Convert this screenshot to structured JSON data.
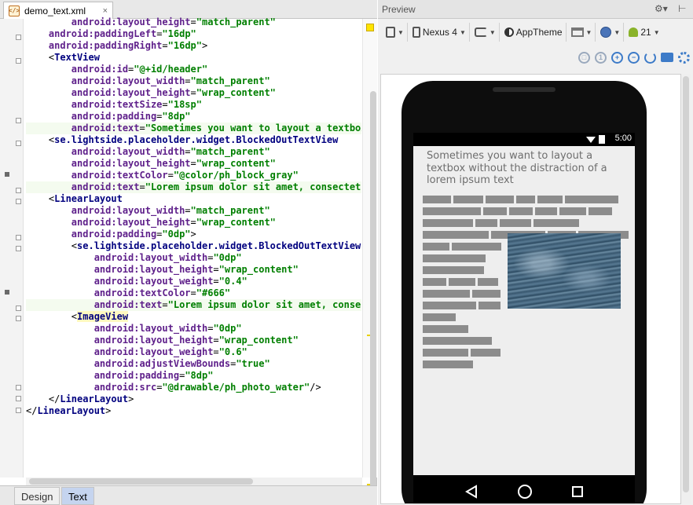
{
  "editor": {
    "file_tab": {
      "name": "demo_text.xml",
      "close": "×"
    },
    "lines": [
      "        android:layout_height=\"match_parent\"",
      "    android:paddingLeft=\"16dp\"",
      "    android:paddingRight=\"16dp\">",
      "    <TextView",
      "        android:id=\"@+id/header\"",
      "        android:layout_width=\"match_parent\"",
      "        android:layout_height=\"wrap_content\"",
      "        android:textSize=\"18sp\"",
      "        android:padding=\"8dp\"",
      "        android:text=\"Sometimes you want to layout a textbox",
      "    <se.lightside.placeholder.widget.BlockedOutTextView",
      "        android:layout_width=\"match_parent\"",
      "        android:layout_height=\"wrap_content\"",
      "        android:textColor=\"@color/ph_block_gray\"",
      "        android:text=\"Lorem ipsum dolor sit amet, consectetur",
      "    <LinearLayout",
      "        android:layout_width=\"match_parent\"",
      "        android:layout_height=\"wrap_content\"",
      "        android:padding=\"0dp\">",
      "        <se.lightside.placeholder.widget.BlockedOutTextView",
      "            android:layout_width=\"0dp\"",
      "            android:layout_height=\"wrap_content\"",
      "            android:layout_weight=\"0.4\"",
      "            android:textColor=\"#666\"",
      "            android:text=\"Lorem ipsum dolor sit amet, consect",
      "        <ImageView",
      "            android:layout_width=\"0dp\"",
      "            android:layout_height=\"wrap_content\"",
      "            android:layout_weight=\"0.6\"",
      "            android:adjustViewBounds=\"true\"",
      "            android:padding=\"8dp\"",
      "            android:src=\"@drawable/ph_photo_water\"/>",
      "    </LinearLayout>",
      "</LinearLayout>"
    ],
    "bottom_tabs": [
      "Design",
      "Text"
    ],
    "active_bottom_tab": "Text"
  },
  "preview": {
    "title": "Preview",
    "title_controls": {
      "settings": "⚙▾",
      "pin": "⊢"
    },
    "toolbar": {
      "device": "Nexus 4",
      "theme": "AppTheme",
      "api": "21"
    },
    "status_time": "5:00",
    "header_text": "Sometimes you want to layout a textbox without the distraction of a lorem ipsum text",
    "icons": [
      "device-icon",
      "phone-icon",
      "rotate-icon",
      "theme-icon",
      "layout-icon",
      "globe-icon",
      "android-icon",
      "zoom-fit-icon",
      "zoom-actual-icon",
      "zoom-in-icon",
      "zoom-out-icon",
      "refresh-icon",
      "camera-icon",
      "gear-icon"
    ]
  }
}
